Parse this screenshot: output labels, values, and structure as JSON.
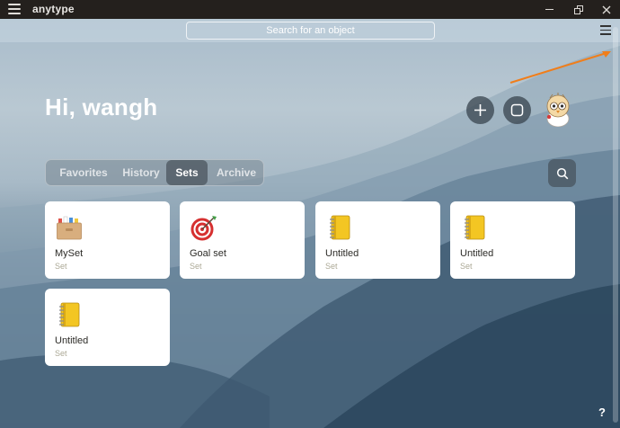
{
  "window": {
    "title": "anytype"
  },
  "header": {
    "search_placeholder": "Search for an object"
  },
  "greeting": "Hi, wangh",
  "tabs": [
    {
      "label": "Favorites",
      "active": false
    },
    {
      "label": "History",
      "active": false
    },
    {
      "label": "Sets",
      "active": true
    },
    {
      "label": "Archive",
      "active": false
    }
  ],
  "cards": [
    {
      "name": "MySet",
      "type": "Set",
      "icon": "file-box-icon"
    },
    {
      "name": "Goal set",
      "type": "Set",
      "icon": "target-icon"
    },
    {
      "name": "Untitled",
      "type": "Set",
      "icon": "notebook-icon"
    },
    {
      "name": "Untitled",
      "type": "Set",
      "icon": "notebook-icon"
    },
    {
      "name": "Untitled",
      "type": "Set",
      "icon": "notebook-icon"
    }
  ],
  "help_label": "?",
  "colors": {
    "accent_arrow": "#f07e1b",
    "card_bg": "#ffffff",
    "titlebar_bg": "#24201d"
  }
}
